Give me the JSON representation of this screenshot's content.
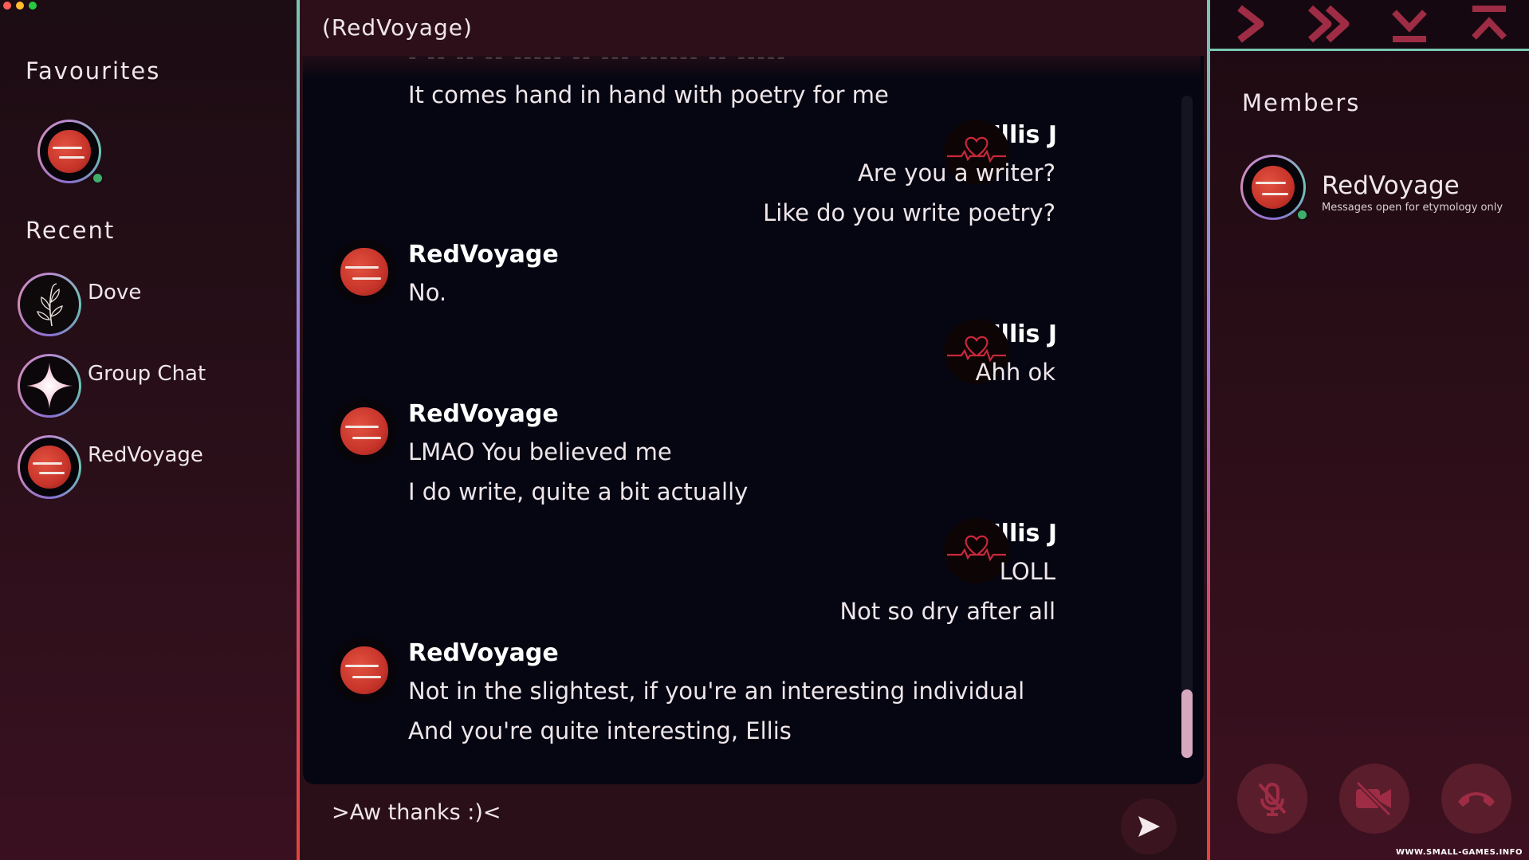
{
  "colors": {
    "accent_red": "#c7342a",
    "online_green": "#3fae6a",
    "icon_red": "#9e2c45",
    "chat_bg": "#050612"
  },
  "sidebar": {
    "favourites_title": "Favourites",
    "recent_title": "Recent",
    "recent": [
      {
        "label": "Dove",
        "icon": "dove-plant-icon"
      },
      {
        "label": "Group Chat",
        "icon": "sparkle-star-icon"
      },
      {
        "label": "RedVoyage",
        "icon": "red-sun-icon"
      }
    ]
  },
  "chat": {
    "title": "(RedVoyage)",
    "partial_top": "- -- -- -- ----- -- --- ------ -- -----",
    "messages": [
      {
        "line": "It comes hand in hand with poetry for me"
      },
      {
        "name": "Ellis J",
        "lines": [
          "Are you a writer?",
          "Like do you write poetry?"
        ]
      },
      {
        "name": "RedVoyage",
        "lines": [
          "No."
        ]
      },
      {
        "name": "Ellis J",
        "lines": [
          "Ahh ok"
        ]
      },
      {
        "name": "RedVoyage",
        "lines": [
          "LMAO You believed me",
          "I do write, quite a bit actually"
        ]
      },
      {
        "name": "Ellis J",
        "lines": [
          "LOLL",
          "Not so dry after all"
        ]
      },
      {
        "name": "RedVoyage",
        "lines": [
          "Not in the slightest, if you're an interesting individual",
          "And you're quite interesting, Ellis"
        ]
      }
    ],
    "composer_text": ">Aw thanks :)<"
  },
  "members": {
    "title": "Members",
    "list": [
      {
        "name": "RedVoyage",
        "status": "Messages open for etymology only"
      }
    ]
  },
  "toolbar": {
    "buttons": [
      "chevron-right-icon",
      "double-chevron-right-icon",
      "skip-down-icon",
      "skip-up-icon"
    ]
  },
  "call_controls": [
    "mute-mic-icon",
    "video-off-icon",
    "hang-up-icon"
  ],
  "watermark": "WWW.SMALL-GAMES.INFO"
}
